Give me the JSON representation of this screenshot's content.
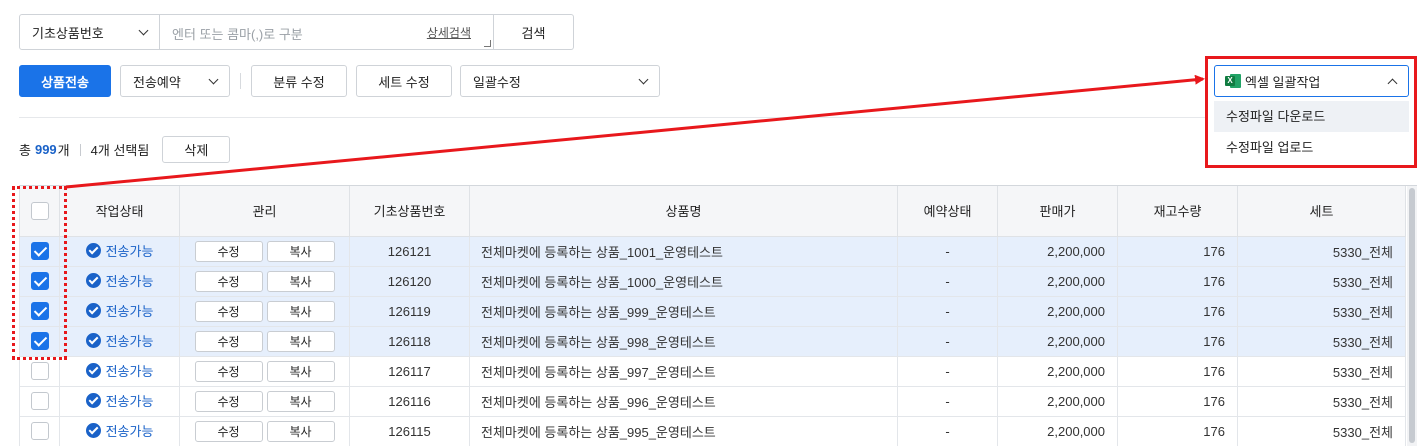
{
  "search": {
    "type_value": "기초상품번호",
    "placeholder": "엔터 또는 콤마(,)로 구분",
    "detail_link": "상세검색",
    "button": "검색"
  },
  "toolbar": {
    "send_button": "상품전송",
    "reserve_select": "전송예약",
    "category_button": "분류 수정",
    "set_button": "세트 수정",
    "bulk_select": "일괄수정"
  },
  "excel": {
    "label": "엑셀 일괄작업",
    "icon": "excel-icon",
    "menu": [
      "수정파일 다운로드",
      "수정파일 업로드"
    ]
  },
  "summary": {
    "total_prefix": "총",
    "total_count": "999",
    "total_suffix": "개",
    "selected_text": "4개 선택됨",
    "delete_button": "삭제"
  },
  "table": {
    "headers": [
      "작업상태",
      "관리",
      "기초상품번호",
      "상품명",
      "예약상태",
      "판매가",
      "재고수량",
      "세트"
    ],
    "edit_label": "수정",
    "copy_label": "복사",
    "rows": [
      {
        "checked": true,
        "status": "전송가능",
        "id": "126121",
        "name": "전체마켓에 등록하는 상품_1001_운영테스트",
        "reserve": "-",
        "price": "2,200,000",
        "stock": "176",
        "set": "5330_전체"
      },
      {
        "checked": true,
        "status": "전송가능",
        "id": "126120",
        "name": "전체마켓에 등록하는 상품_1000_운영테스트",
        "reserve": "-",
        "price": "2,200,000",
        "stock": "176",
        "set": "5330_전체"
      },
      {
        "checked": true,
        "status": "전송가능",
        "id": "126119",
        "name": "전체마켓에 등록하는 상품_999_운영테스트",
        "reserve": "-",
        "price": "2,200,000",
        "stock": "176",
        "set": "5330_전체"
      },
      {
        "checked": true,
        "status": "전송가능",
        "id": "126118",
        "name": "전체마켓에 등록하는 상품_998_운영테스트",
        "reserve": "-",
        "price": "2,200,000",
        "stock": "176",
        "set": "5330_전체"
      },
      {
        "checked": false,
        "status": "전송가능",
        "id": "126117",
        "name": "전체마켓에 등록하는 상품_997_운영테스트",
        "reserve": "-",
        "price": "2,200,000",
        "stock": "176",
        "set": "5330_전체"
      },
      {
        "checked": false,
        "status": "전송가능",
        "id": "126116",
        "name": "전체마켓에 등록하는 상품_996_운영테스트",
        "reserve": "-",
        "price": "2,200,000",
        "stock": "176",
        "set": "5330_전체"
      },
      {
        "checked": false,
        "status": "전송가능",
        "id": "126115",
        "name": "전체마켓에 등록하는 상품_995_운영테스트",
        "reserve": "-",
        "price": "2,200,000",
        "stock": "176",
        "set": "5330_전체"
      }
    ]
  },
  "colors": {
    "primary": "#1a73e8",
    "status_blue": "#1a62c8",
    "annotation_red": "#e8181c",
    "selected_row": "#e6effc"
  }
}
